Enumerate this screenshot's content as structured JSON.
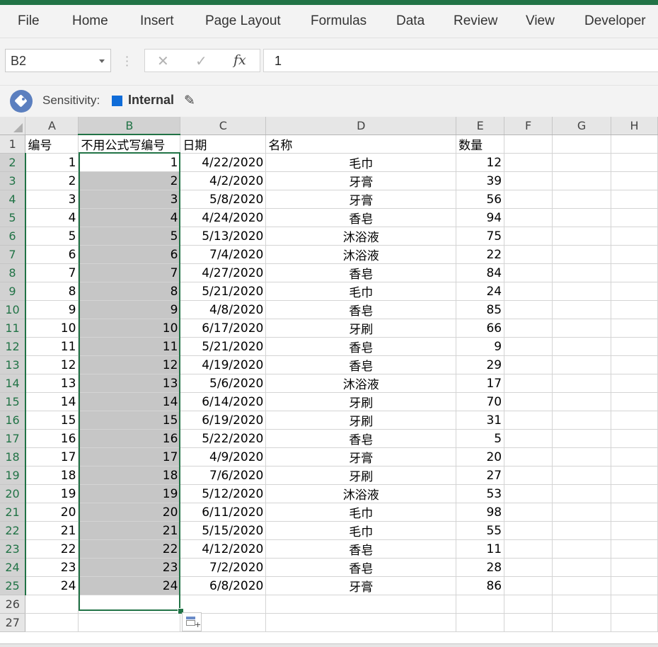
{
  "ribbon": {
    "tabs": [
      "File",
      "Home",
      "Insert",
      "Page Layout",
      "Formulas",
      "Data",
      "Review",
      "View",
      "Developer"
    ]
  },
  "formula_bar": {
    "name_box": "B2",
    "cancel_icon": "✕",
    "enter_icon": "✓",
    "fx_label": "fx",
    "formula_value": "1"
  },
  "sensitivity": {
    "label": "Sensitivity:",
    "value": "Internal",
    "color": "#0f6cd8"
  },
  "grid": {
    "columns": [
      "A",
      "B",
      "C",
      "D",
      "E",
      "F",
      "G",
      "H"
    ],
    "selected_column": "B",
    "header_row": [
      "编号",
      "不用公式写编号",
      "日期",
      "名称",
      "数量"
    ],
    "rows": [
      [
        "1",
        "1",
        "4/22/2020",
        "毛巾",
        "12"
      ],
      [
        "2",
        "2",
        "4/2/2020",
        "牙膏",
        "39"
      ],
      [
        "3",
        "3",
        "5/8/2020",
        "牙膏",
        "56"
      ],
      [
        "4",
        "4",
        "4/24/2020",
        "香皂",
        "94"
      ],
      [
        "5",
        "5",
        "5/13/2020",
        "沐浴液",
        "75"
      ],
      [
        "6",
        "6",
        "7/4/2020",
        "沐浴液",
        "22"
      ],
      [
        "7",
        "7",
        "4/27/2020",
        "香皂",
        "84"
      ],
      [
        "8",
        "8",
        "5/21/2020",
        "毛巾",
        "24"
      ],
      [
        "9",
        "9",
        "4/8/2020",
        "香皂",
        "85"
      ],
      [
        "10",
        "10",
        "6/17/2020",
        "牙刷",
        "66"
      ],
      [
        "11",
        "11",
        "5/21/2020",
        "香皂",
        "9"
      ],
      [
        "12",
        "12",
        "4/19/2020",
        "香皂",
        "29"
      ],
      [
        "13",
        "13",
        "5/6/2020",
        "沐浴液",
        "17"
      ],
      [
        "14",
        "14",
        "6/14/2020",
        "牙刷",
        "70"
      ],
      [
        "15",
        "15",
        "6/19/2020",
        "牙刷",
        "31"
      ],
      [
        "16",
        "16",
        "5/22/2020",
        "香皂",
        "5"
      ],
      [
        "17",
        "17",
        "4/9/2020",
        "牙膏",
        "20"
      ],
      [
        "18",
        "18",
        "7/6/2020",
        "牙刷",
        "27"
      ],
      [
        "19",
        "19",
        "5/12/2020",
        "沐浴液",
        "53"
      ],
      [
        "20",
        "20",
        "6/11/2020",
        "毛巾",
        "98"
      ],
      [
        "21",
        "21",
        "5/15/2020",
        "毛巾",
        "55"
      ],
      [
        "22",
        "22",
        "4/12/2020",
        "香皂",
        "11"
      ],
      [
        "23",
        "23",
        "7/2/2020",
        "香皂",
        "28"
      ],
      [
        "24",
        "24",
        "6/8/2020",
        "牙膏",
        "86"
      ]
    ],
    "row_numbers": [
      "1",
      "2",
      "3",
      "4",
      "5",
      "6",
      "7",
      "8",
      "9",
      "10",
      "11",
      "12",
      "13",
      "14",
      "15",
      "16",
      "17",
      "18",
      "19",
      "20",
      "21",
      "22",
      "23",
      "24",
      "25",
      "26",
      "27"
    ]
  }
}
